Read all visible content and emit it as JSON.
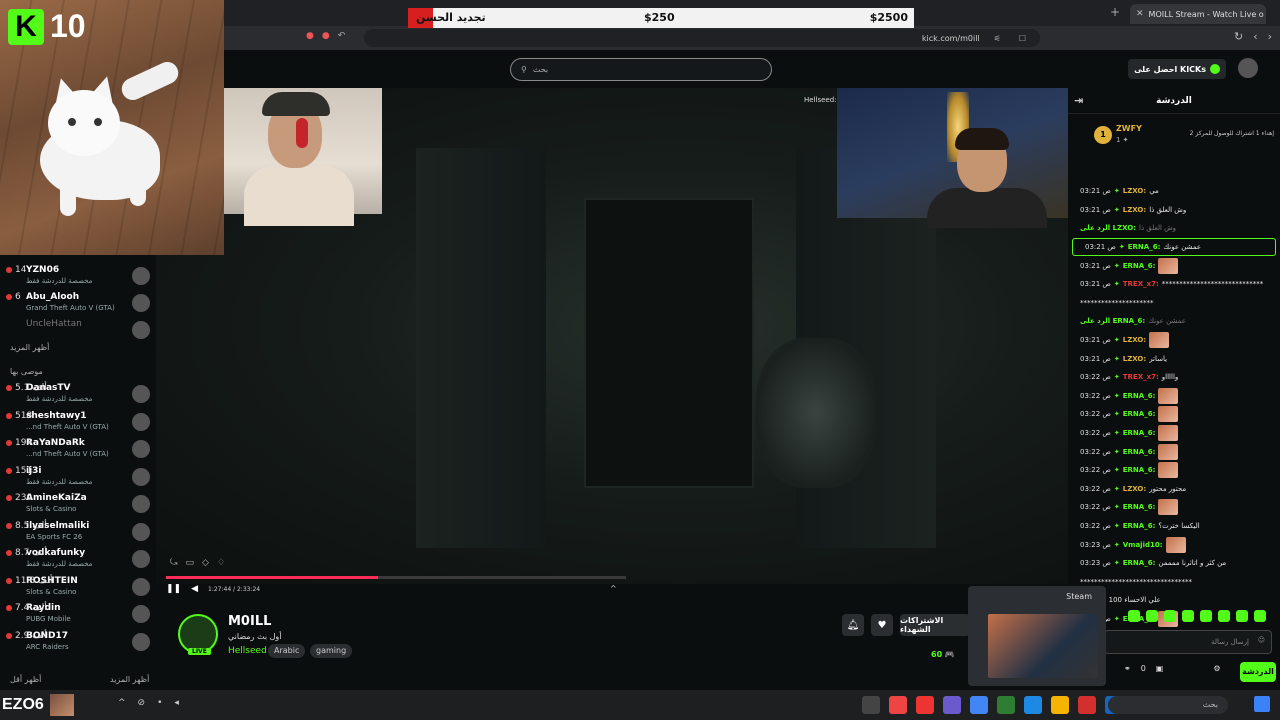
{
  "browser": {
    "tab_title": "MOILL Stream - Watch Live o",
    "url": "kick.com/m0ill",
    "new_tab_icon": "plus-icon"
  },
  "goal": {
    "label": "تجديد الحسن",
    "current": "$250",
    "target": "$2500",
    "progress": 0.1,
    "fill_color": "#d81f1f"
  },
  "overlay": {
    "k_letter": "K",
    "count": "10"
  },
  "header": {
    "search_placeholder": "بحث",
    "kicks_label": "احصل على KICKs"
  },
  "sidebar": {
    "top_items": [
      {
        "name": "YZN06",
        "count": "14",
        "sub": "مخصصة للدردشة فقط"
      },
      {
        "name": "Abu_Alooh",
        "count": "6",
        "sub": "Grand Theft Auto V (GTA)"
      },
      {
        "name": "UncleHattan",
        "count": "",
        "sub": ""
      }
    ],
    "show_more_1": "أظهر المزيد",
    "recommended_title": "موصى بها",
    "recommended": [
      {
        "name": "DanasTV",
        "count": "5.1 ألف",
        "sub": "مخصصة للدردشة فقط"
      },
      {
        "name": "sheshtawy1",
        "count": "518",
        "sub": "...nd Theft Auto V (GTA)"
      },
      {
        "name": "RaYaNDaRk",
        "count": "194",
        "sub": "...nd Theft Auto V (GTA)"
      },
      {
        "name": "ij3i",
        "count": "151",
        "sub": "مخصصة للدردشة فقط"
      },
      {
        "name": "AmineKaiZa",
        "count": "230",
        "sub": "Slots & Casino"
      },
      {
        "name": "ilyaselmaliki",
        "count": "8.5 ألف",
        "sub": "EA Sports FC 26"
      },
      {
        "name": "vodkafunky",
        "count": "8.7 ألف",
        "sub": "مخصصة للدردشة فقط"
      },
      {
        "name": "ROSHTEIN",
        "count": "11.8 ألف",
        "sub": "Slots & Casino"
      },
      {
        "name": "Raydin",
        "count": "7.4 ألف",
        "sub": "PUBG Mobile"
      },
      {
        "name": "BOND17",
        "count": "2.9 ألف",
        "sub": "ARC Raiders"
      }
    ],
    "show_less": "أظهر أقل",
    "show_more_2": "أظهر المزيد"
  },
  "stream": {
    "cam3_label": "Hellseed:",
    "time": "1:27:44 / 2:33:24",
    "progress": 0.46
  },
  "channel": {
    "name": "M0ILL",
    "title": "أول بث رمضاني",
    "category": "Hellseed",
    "tags": [
      "Arabic",
      "gaming"
    ],
    "live_badge": "LIVE",
    "subscribe_label": "الاشتراكات الشهداء",
    "viewers": "60 🎮"
  },
  "chat": {
    "title": "الدردشة",
    "pinned": {
      "user": "ZWFY",
      "count": "1",
      "message": "إهداء 1 اشتراك للوصول للمركز 2"
    },
    "lines": [
      {
        "time": "03:21 ص",
        "user": "LZXO:",
        "msg": "مي",
        "cls": "gold"
      },
      {
        "time": "03:21 ص",
        "user": "LZXO:",
        "msg": "وش العلق ذا",
        "cls": "gold"
      },
      {
        "time": "",
        "user": "الرد على LZXO:",
        "msg": "وش العلق ذا",
        "cls": "",
        "reply": true
      },
      {
        "time": "03:21 ص",
        "user": "ERNA_6:",
        "msg": "عمشن عونك",
        "cls": "",
        "hl": true
      },
      {
        "time": "03:21 ص",
        "user": "ERNA_6:",
        "msg": "",
        "cls": "",
        "emote": true
      },
      {
        "time": "03:21 ص",
        "user": "TREX_x7:",
        "msg": "*****************************",
        "cls": "red"
      },
      {
        "time": "",
        "user": "",
        "msg": "*********************",
        "cls": ""
      },
      {
        "time": "",
        "user": "الرد على ERNA_6:",
        "msg": "عمشن عونك",
        "cls": "",
        "reply": true
      },
      {
        "time": "03:21 ص",
        "user": "LZXO:",
        "msg": "",
        "cls": "gold",
        "emote": true
      },
      {
        "time": "03:21 ص",
        "user": "LZXO:",
        "msg": "ياساتر",
        "cls": "gold"
      },
      {
        "time": "03:22 ص",
        "user": "TREX_x7:",
        "msg": "واااااو",
        "cls": "red"
      },
      {
        "time": "03:22 ص",
        "user": "ERNA_6:",
        "msg": "",
        "cls": "",
        "emote": true
      },
      {
        "time": "03:22 ص",
        "user": "ERNA_6:",
        "msg": "",
        "cls": "",
        "emote": true
      },
      {
        "time": "03:22 ص",
        "user": "ERNA_6:",
        "msg": "",
        "cls": "",
        "emote": true
      },
      {
        "time": "03:22 ص",
        "user": "ERNA_6:",
        "msg": "",
        "cls": "",
        "emote": true
      },
      {
        "time": "03:22 ص",
        "user": "ERNA_6:",
        "msg": "",
        "cls": "",
        "emote": true
      },
      {
        "time": "03:22 ص",
        "user": "LZXO:",
        "msg": "محتور محتور",
        "cls": "gold"
      },
      {
        "time": "03:22 ص",
        "user": "ERNA_6:",
        "msg": "",
        "cls": "",
        "emote": true
      },
      {
        "time": "03:22 ص",
        "user": "ERNA_6:",
        "msg": "اليكسا خترت؟",
        "cls": ""
      },
      {
        "time": "03:23 ص",
        "user": "Vmajid10:",
        "msg": "",
        "cls": "",
        "emote": true
      },
      {
        "time": "03:23 ص",
        "user": "ERNA_6:",
        "msg": "من كثر و اتاثرنا ممممن",
        "cls": ""
      },
      {
        "time": "",
        "user": "",
        "msg": "********************************",
        "cls": ""
      },
      {
        "time": "",
        "user": "",
        "msg": "علي الاحساء 100 مقتي 30",
        "cls": ""
      },
      {
        "time": "03:23 ص",
        "user": "ERNA_6:",
        "msg": "",
        "cls": "",
        "emote": true
      }
    ],
    "input_placeholder": "إرسال رسالة",
    "points": "0",
    "send_label": "الدردشة"
  },
  "steam_popup": {
    "label": "Steam"
  },
  "taskbar": {
    "left_text": "EZO6",
    "search_placeholder": "بحث"
  }
}
